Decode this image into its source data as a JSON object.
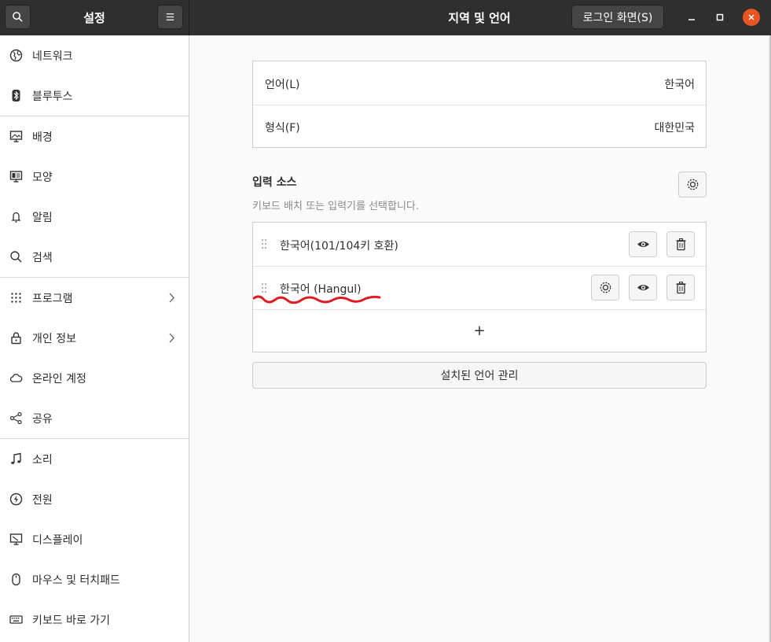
{
  "header": {
    "app_title": "설정",
    "page_title": "지역 및 언어",
    "login_button": "로그인 화면(S)"
  },
  "sidebar": {
    "items": [
      {
        "label": "네트워크",
        "icon": "network-icon"
      },
      {
        "label": "블루투스",
        "icon": "bluetooth-icon"
      },
      {
        "label": "배경",
        "icon": "background-icon"
      },
      {
        "label": "모양",
        "icon": "appearance-icon"
      },
      {
        "label": "알림",
        "icon": "bell-icon"
      },
      {
        "label": "검색",
        "icon": "search-icon"
      },
      {
        "label": "프로그램",
        "icon": "apps-grid-icon"
      },
      {
        "label": "개인 정보",
        "icon": "lock-icon"
      },
      {
        "label": "온라인 계정",
        "icon": "cloud-icon"
      },
      {
        "label": "공유",
        "icon": "share-icon"
      },
      {
        "label": "소리",
        "icon": "music-note-icon"
      },
      {
        "label": "전원",
        "icon": "power-icon"
      },
      {
        "label": "디스플레이",
        "icon": "display-icon"
      },
      {
        "label": "마우스 및 터치패드",
        "icon": "mouse-icon"
      },
      {
        "label": "키보드 바로 가기",
        "icon": "keyboard-icon"
      }
    ]
  },
  "main": {
    "language": {
      "label": "언어(L)",
      "value": "한국어"
    },
    "formats": {
      "label": "형식(F)",
      "value": "대한민국"
    },
    "input_sources": {
      "title": "입력 소스",
      "subtitle": "키보드 배치 또는 입력기를 선택합니다.",
      "items": [
        {
          "label": "한국어(101/104키 호환)"
        },
        {
          "label": "한국어 (Hangul)"
        }
      ],
      "add_symbol": "+"
    },
    "manage_languages": "설치된 언어 관리"
  },
  "colors": {
    "header_bg": "#2f2f2f",
    "accent_close": "#e95420",
    "annotation_red": "#e01b24"
  }
}
